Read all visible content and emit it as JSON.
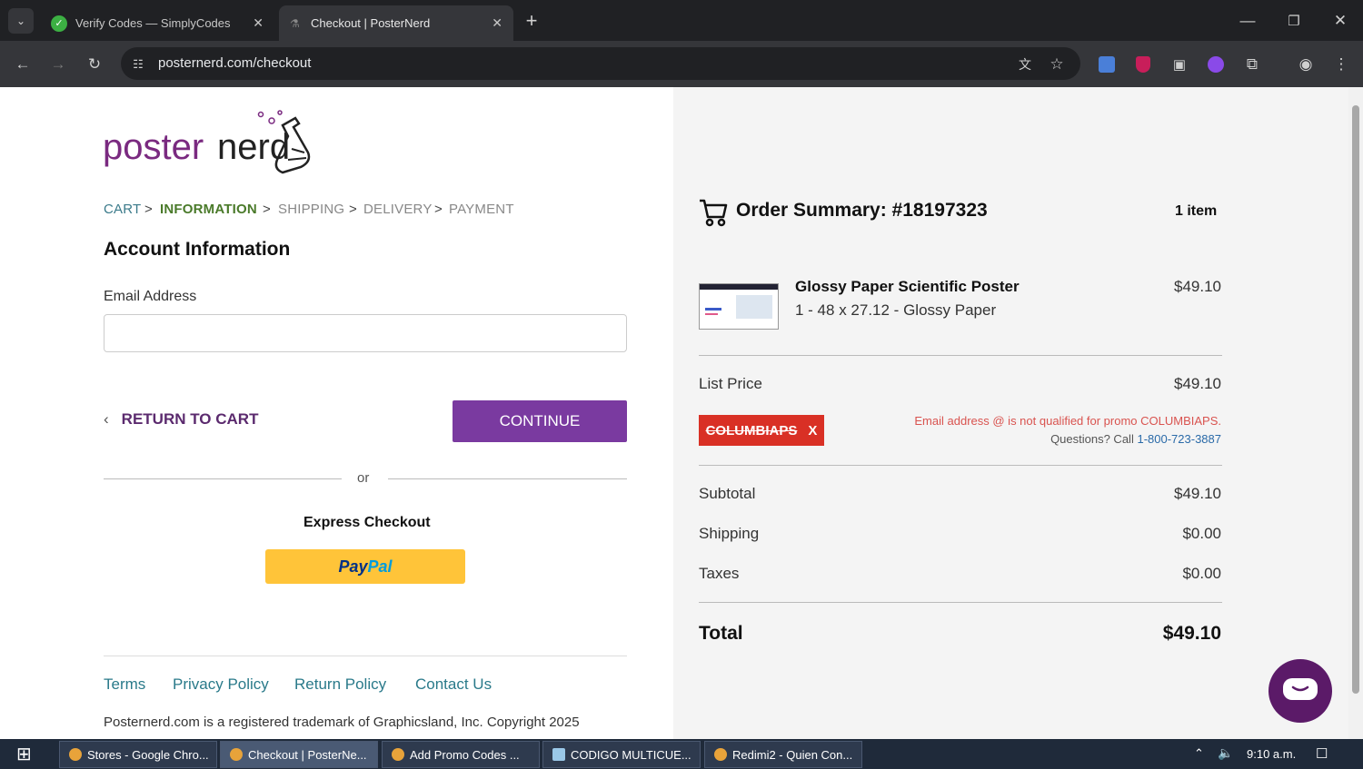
{
  "browser": {
    "tabs": [
      {
        "title": "Verify Codes — SimplyCodes"
      },
      {
        "title": "Checkout | PosterNerd"
      }
    ],
    "url": "posternerd.com/checkout"
  },
  "page": {
    "logo_text_1": "poster",
    "logo_text_2": "nerd",
    "breadcrumb": [
      "CART",
      "INFORMATION",
      "SHIPPING",
      "DELIVERY",
      "PAYMENT"
    ],
    "breadcrumb_sep": ">",
    "section_title": "Account Information",
    "email_label": "Email Address",
    "email_value": "",
    "return_label": "RETURN TO CART",
    "continue_label": "CONTINUE",
    "or_label": "or",
    "express_label": "Express Checkout",
    "paypal_pay": "Pay",
    "paypal_pal": "Pal",
    "footer_links": [
      "Terms",
      "Privacy Policy",
      "Return Policy",
      "Contact Us"
    ],
    "trademark": "Posternerd.com is a registered trademark of Graphicsland, Inc. Copyright 2025"
  },
  "summary": {
    "title": "Order Summary: #18197323",
    "item_count": "1 item",
    "product_name": "Glossy Paper Scientific Poster",
    "product_desc": "1 - 48 x 27.12 - Glossy Paper",
    "product_price": "$49.10",
    "list_price_label": "List Price",
    "list_price": "$49.10",
    "promo_code": "COLUMBIAPS",
    "promo_remove": "X",
    "promo_message": "Email address @ is not qualified for promo COLUMBIAPS.",
    "promo_question": "Questions? Call",
    "promo_phone": "1-800-723-3887",
    "subtotal_label": "Subtotal",
    "subtotal": "$49.10",
    "shipping_label": "Shipping",
    "shipping": "$0.00",
    "taxes_label": "Taxes",
    "taxes": "$0.00",
    "total_label": "Total",
    "total": "$49.10"
  },
  "taskbar": {
    "items": [
      "Stores - Google Chro...",
      "Checkout | PosterNe...",
      "Add Promo Codes ...",
      "CODIGO MULTICUE...",
      "Redimi2 - Quien Con..."
    ],
    "time": "9:10 a.m."
  },
  "colors": {
    "accent": "#7a3aa0",
    "breadcrumb_active": "#4a7a2a",
    "link": "#2a7a8a",
    "error": "#d93025"
  }
}
